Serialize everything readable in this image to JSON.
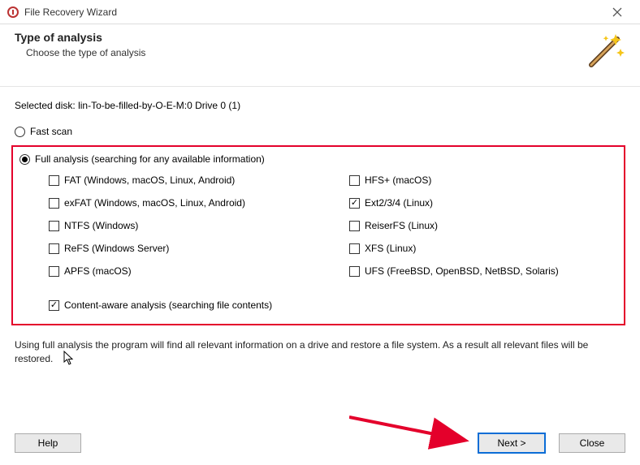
{
  "window": {
    "title": "File Recovery Wizard"
  },
  "header": {
    "title": "Type of analysis",
    "subtitle": "Choose the type of analysis"
  },
  "selected_disk": {
    "label": "Selected disk:",
    "value": "lin-To-be-filled-by-O-E-M:0 Drive 0 (1)"
  },
  "scan_options": {
    "fast": {
      "label": "Fast scan",
      "selected": false
    },
    "full": {
      "label": "Full analysis (searching for any available information)",
      "selected": true
    }
  },
  "filesystems": {
    "left": [
      {
        "label": "FAT (Windows, macOS, Linux, Android)",
        "checked": false
      },
      {
        "label": "exFAT (Windows, macOS, Linux, Android)",
        "checked": false
      },
      {
        "label": "NTFS (Windows)",
        "checked": false
      },
      {
        "label": "ReFS (Windows Server)",
        "checked": false
      },
      {
        "label": "APFS (macOS)",
        "checked": false
      }
    ],
    "right": [
      {
        "label": "HFS+ (macOS)",
        "checked": false
      },
      {
        "label": "Ext2/3/4 (Linux)",
        "checked": true
      },
      {
        "label": "ReiserFS (Linux)",
        "checked": false
      },
      {
        "label": "XFS (Linux)",
        "checked": false
      },
      {
        "label": "UFS (FreeBSD, OpenBSD, NetBSD, Solaris)",
        "checked": false
      }
    ]
  },
  "content_aware": {
    "label": "Content-aware analysis (searching file contents)",
    "checked": true
  },
  "note": "Using full analysis the program will find all relevant information on a drive and restore a file system. As a result all relevant files will be restored.",
  "buttons": {
    "help": "Help",
    "next": "Next >",
    "close": "Close"
  }
}
